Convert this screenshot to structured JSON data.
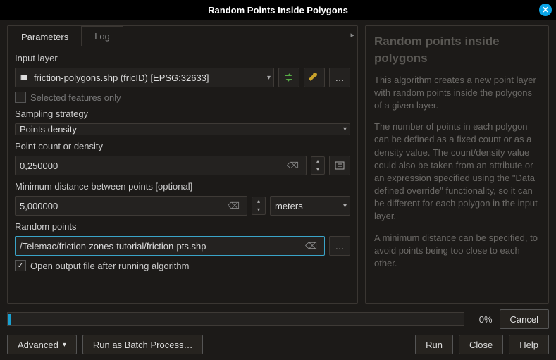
{
  "title": "Random Points Inside Polygons",
  "tabs": {
    "parameters": "Parameters",
    "log": "Log"
  },
  "form": {
    "input_label": "Input layer",
    "input_value": "friction-polygons.shp (fricID) [EPSG:32633]",
    "selected_only": "Selected features only",
    "strategy_label": "Sampling strategy",
    "strategy_value": "Points density",
    "count_label": "Point count or density",
    "count_value": "0,250000",
    "mindist_label": "Minimum distance between points [optional]",
    "mindist_value": "5,000000",
    "mindist_unit": "meters",
    "output_label": "Random points",
    "output_value": "/Telemac/friction-zones-tutorial/friction-pts.shp",
    "open_after": "Open output file after running algorithm"
  },
  "help": {
    "title": "Random points inside polygons",
    "p1": "This algorithm creates a new point layer with random points inside the polygons of a given layer.",
    "p2": "The number of points in each polygon can be defined as a fixed count or as a density value. The count/density value could also be taken from an attribute or an expression specified using the \"Data defined override\" functionality, so it can be different for each polygon in the input layer.",
    "p3": "A minimum distance can be specified, to avoid points being too close to each other."
  },
  "progress_pct": "0%",
  "buttons": {
    "cancel": "Cancel",
    "advanced": "Advanced",
    "batch": "Run as Batch Process…",
    "run": "Run",
    "close": "Close",
    "help": "Help"
  }
}
